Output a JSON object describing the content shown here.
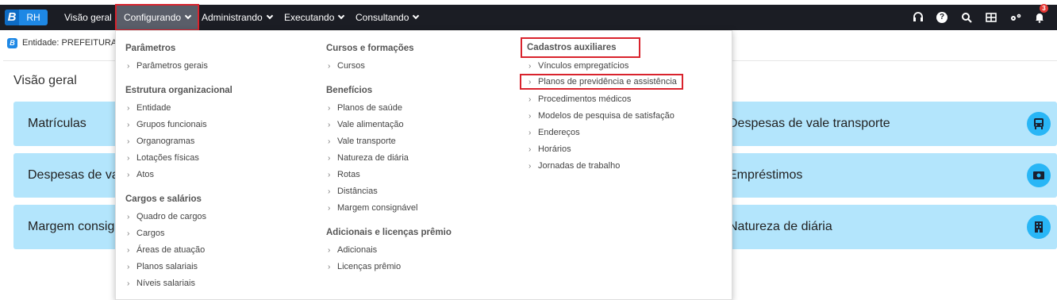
{
  "nav": {
    "logo_letter": "B",
    "logo_text": "RH",
    "items": [
      "Visão geral",
      "Configurando",
      "Administrando",
      "Executando",
      "Consultando"
    ],
    "notification_count": "3"
  },
  "entity": {
    "badge": "B",
    "text": "Entidade: PREFEITURA D"
  },
  "page": {
    "title": "Visão geral",
    "cards_left": [
      "Matrículas",
      "Despesas de val",
      "Margem consig"
    ],
    "cards_right": [
      "Despesas de vale transporte",
      "Empréstimos",
      "Natureza de diária"
    ],
    "card_bg": "#b3e5fc",
    "icon_bg": "#29b6f6"
  },
  "menu": {
    "col1": {
      "s1_title": "Parâmetros",
      "s1_items": [
        "Parâmetros gerais"
      ],
      "s2_title": "Estrutura organizacional",
      "s2_items": [
        "Entidade",
        "Grupos funcionais",
        "Organogramas",
        "Lotações físicas",
        "Atos"
      ],
      "s3_title": "Cargos e salários",
      "s3_items": [
        "Quadro de cargos",
        "Cargos",
        "Áreas de atuação",
        "Planos salariais",
        "Níveis salariais"
      ]
    },
    "col2": {
      "s1_title": "Cursos e formações",
      "s1_items": [
        "Cursos"
      ],
      "s2_title": "Benefícios",
      "s2_items": [
        "Planos de saúde",
        "Vale alimentação",
        "Vale transporte",
        "Natureza de diária",
        "Rotas",
        "Distâncias",
        "Margem consignável"
      ],
      "s3_title": "Adicionais e licenças prêmio",
      "s3_items": [
        "Adicionais",
        "Licenças prêmio"
      ]
    },
    "col3": {
      "s1_title": "Cadastros auxiliares",
      "s1_items": [
        "Vínculos empregatícios",
        "Planos de previdência e assistência",
        "Procedimentos médicos",
        "Modelos de pesquisa de satisfação",
        "Endereços",
        "Horários",
        "Jornadas de trabalho"
      ]
    },
    "arrow": "›",
    "highlight_color": "#d9232d"
  }
}
